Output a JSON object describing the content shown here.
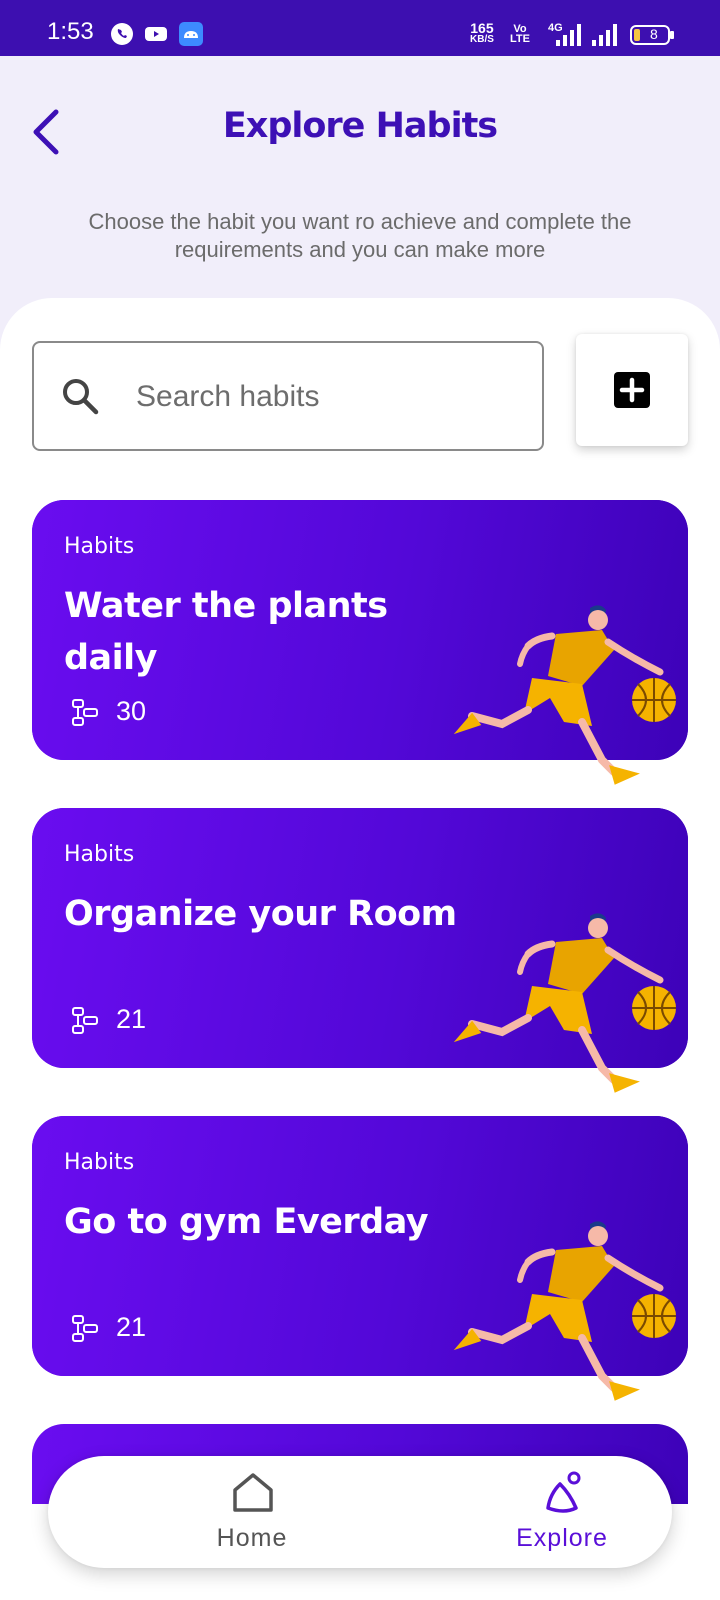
{
  "status_bar": {
    "time": "1:53",
    "net_speed_value": "165",
    "net_speed_unit": "KB/S",
    "volte_top": "Vo",
    "volte_bottom": "LTE",
    "network": "4G",
    "battery": "8"
  },
  "header": {
    "title": "Explore Habits",
    "subtitle": "Choose the habit you want ro achieve and complete the requirements and you can make more"
  },
  "search": {
    "placeholder": "Search habits"
  },
  "habits": [
    {
      "category": "Habits",
      "title": "Water the plants daily",
      "count": "30"
    },
    {
      "category": "Habits",
      "title": "Organize your Room",
      "count": "21"
    },
    {
      "category": "Habits",
      "title": "Go to gym Everday",
      "count": "21"
    }
  ],
  "bottom_nav": {
    "items": [
      {
        "label": "Home",
        "icon": "home-icon",
        "active": false
      },
      {
        "label": "Explore",
        "icon": "explore-icon",
        "active": true
      }
    ]
  },
  "colors": {
    "primary": "#3d10b5",
    "card_start": "#6a0df0",
    "card_end": "#3d02b8",
    "accent_orange": "#f5a623"
  }
}
